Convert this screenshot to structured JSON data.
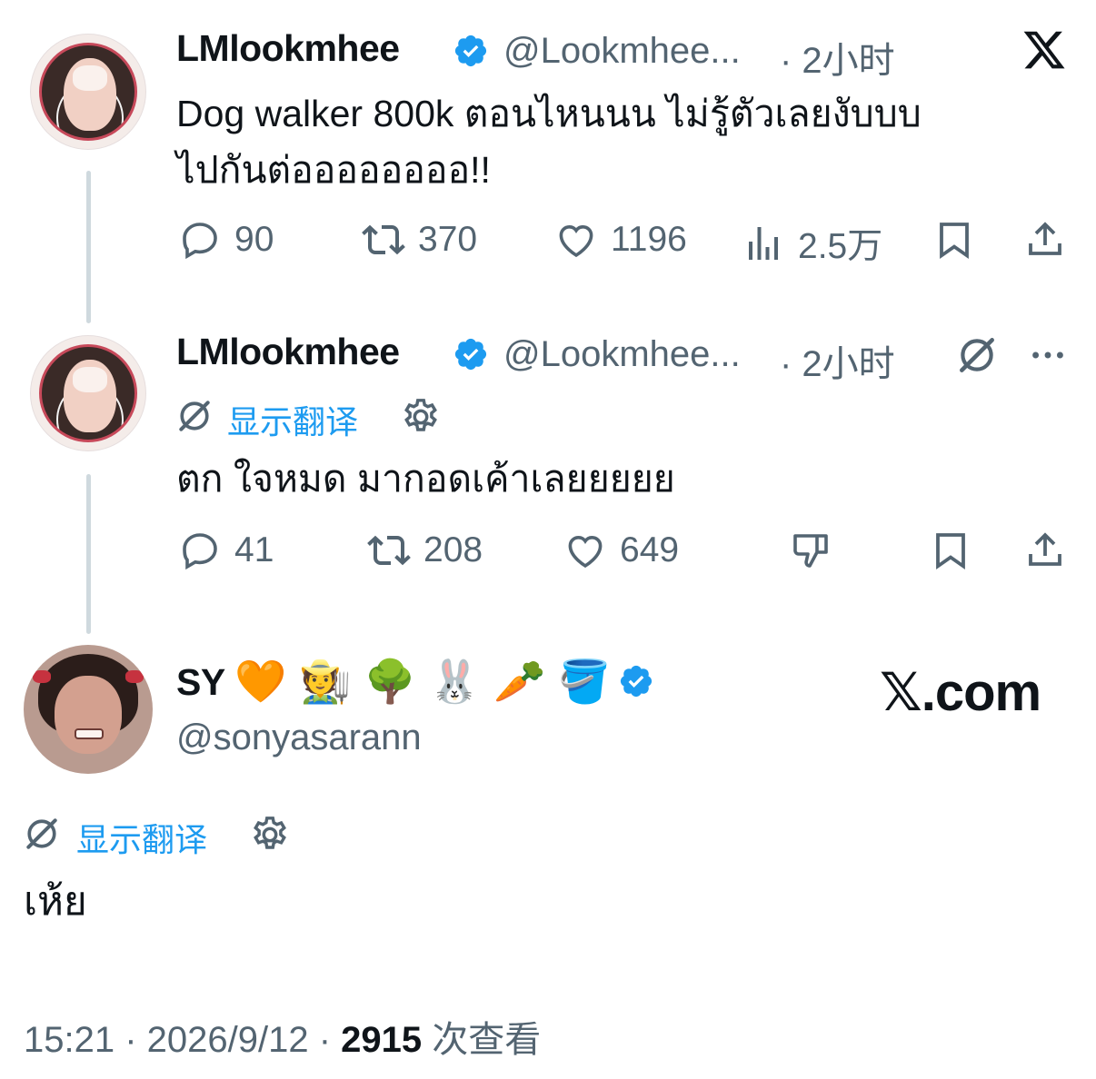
{
  "tweet1": {
    "name": "LMlookmhee",
    "handle": "@Lookmhee...",
    "time": "· 2小时",
    "text_line1": "Dog walker 800k ตอนไหนนน ไม่รู้ตัวเลยงับบบ",
    "text_line2": "ไปกันต่ออออออออ!!",
    "replies": "90",
    "retweets": "370",
    "likes": "1196",
    "views": "2.5万"
  },
  "tweet2": {
    "name": "LMlookmhee",
    "handle": "@Lookmhee...",
    "time": "· 2小时",
    "translate_label": "显示翻译",
    "text": "ตก ใจหมด มากอดเค้าเลยยยยย",
    "replies": "41",
    "retweets": "208",
    "likes": "649"
  },
  "tweet3": {
    "name": "SY",
    "emojis": [
      "🧡",
      "🧑‍🌾",
      "🌳",
      "🐰",
      "🥕",
      "🪣"
    ],
    "handle": "@sonyasarann",
    "translate_label": "显示翻译",
    "text": "เห้ย",
    "timestamp": "15:21 · 2026/9/12 · ",
    "views_count": "2915",
    "views_label": " 次查看"
  },
  "brand": {
    "xcom": "𝕏.com"
  },
  "colors": {
    "accent": "#1d9bf0",
    "muted": "#536471",
    "text": "#0f1419"
  }
}
